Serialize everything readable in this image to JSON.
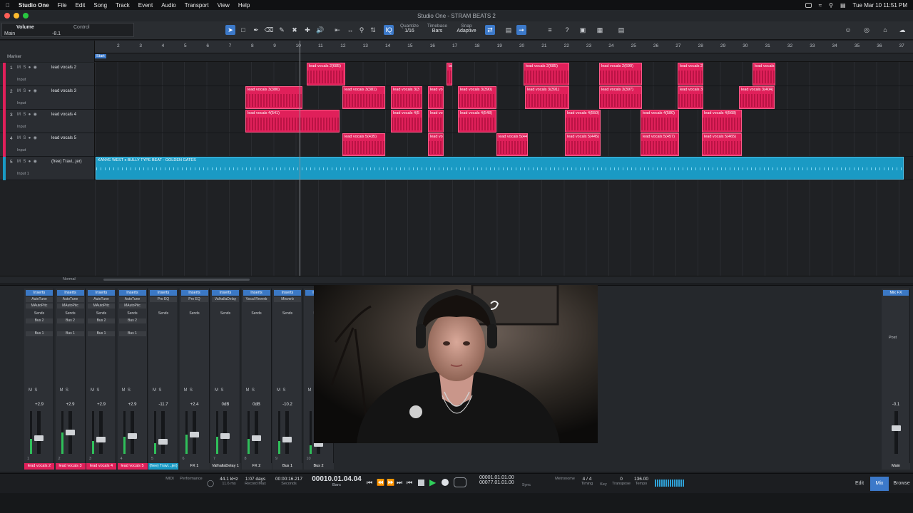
{
  "menubar": {
    "app_name": "Studio One",
    "items": [
      "File",
      "Edit",
      "Song",
      "Track",
      "Event",
      "Audio",
      "Transport",
      "View",
      "Help"
    ],
    "clock": "Tue Mar 10  11:51 PM"
  },
  "window": {
    "title": "Studio One - STRAM BEATS 2"
  },
  "toolbar": {
    "volume_label": "Volume",
    "control_label": "Control",
    "main_label": "Main",
    "volume_value": "-8.1",
    "quantize_label": "Quantize",
    "quantize_value": "1/16",
    "timebase_label": "Timebase",
    "timebase_value": "Bars",
    "snap_label": "Snap",
    "snap_value": "Adaptive"
  },
  "arrange": {
    "marker_label": "Marker",
    "start_label": "Start",
    "bars": [
      "2",
      "3",
      "4",
      "5",
      "6",
      "7",
      "8",
      "9",
      "10",
      "11",
      "12",
      "13",
      "14",
      "15",
      "16",
      "17",
      "18",
      "19",
      "20",
      "21",
      "22",
      "23",
      "24",
      "25",
      "26",
      "27",
      "28",
      "29",
      "30",
      "31",
      "32",
      "33",
      "34",
      "35",
      "36",
      "37"
    ],
    "tracks": [
      {
        "num": "1",
        "name": "lead vocals 2",
        "input": "Input",
        "color": "#e0205a"
      },
      {
        "num": "2",
        "name": "lead vocals 3",
        "input": "Input",
        "color": "#e0205a"
      },
      {
        "num": "3",
        "name": "lead vocals 4",
        "input": "Input",
        "color": "#e0205a"
      },
      {
        "num": "4",
        "name": "lead vocals 5",
        "input": "Input",
        "color": "#e0205a"
      },
      {
        "num": "5",
        "name": "(free) Travi...jer)",
        "input": "Input 1",
        "color": "#1a9ac4"
      }
    ],
    "clips": {
      "row1": [
        "lead vocals 2(685)",
        "la",
        "lead vocals 2(685)",
        "lead vocals 2(690)",
        "lead vocals 2(",
        "lead vocals"
      ],
      "row2": [
        "lead vocals 3(380)",
        "lead vocals 3(381)",
        "lead vocals 3(3",
        "lead vo",
        "lead vocals 3(390)",
        "lead vocals 3(391)",
        "lead vocals 3(397)",
        "lead vocals 3(",
        "lead vocals 3(404)"
      ],
      "row3": [
        "lead vocals 4(541)",
        "lead vocals 4(5",
        "lead vo",
        "lead vocals 4(548)",
        "lead vocals 4(550)",
        "lead vocals 4(580)",
        "lead vocals 4(568)"
      ],
      "row4": [
        "lead vocals 5(435)",
        "lead vo",
        "lead vocals 5(442",
        "lead vocals 5(445)",
        "lead vocals 5(457)",
        "lead vocals 5(465)"
      ],
      "beat": "KANYE WEST x BULLY TYPE BEAT - GOLDEN GATES"
    },
    "footer_mode": "Normal"
  },
  "mixer": {
    "inserts_label": "Inserts",
    "sends_label": "Sends",
    "channels": [
      {
        "name": "lead vocals 2",
        "plugins": [
          "AutoTune",
          "MAutoPitc"
        ],
        "send": "Bus 2",
        "bus": "Bus 1",
        "vol": "+2.9",
        "num": "1",
        "color": "#e0205a",
        "level": 0.35
      },
      {
        "name": "lead vocals 3",
        "plugins": [
          "AutoTune",
          "MAutoPitc"
        ],
        "send": "Bus 2",
        "bus": "Bus 1",
        "vol": "+2.9",
        "num": "2",
        "color": "#e0205a",
        "level": 0.5
      },
      {
        "name": "lead vocals 4",
        "plugins": [
          "AutoTune",
          "MAutoPitc"
        ],
        "send": "Bus 2",
        "bus": "Bus 1",
        "vol": "+2.9",
        "num": "3",
        "color": "#e0205a",
        "level": 0.3
      },
      {
        "name": "lead vocals 5",
        "plugins": [
          "AutoTune",
          "MAutoPitc"
        ],
        "send": "Bus 2",
        "bus": "Bus 1",
        "vol": "+2.9",
        "num": "4",
        "color": "#e0205a",
        "level": 0.4
      },
      {
        "name": "(free) Travi...jer)",
        "plugins": [
          "Pro EQ",
          ""
        ],
        "send": "",
        "bus": "",
        "vol": "-11.7",
        "num": "5",
        "color": "#1a9ac4",
        "level": 0.25
      },
      {
        "name": "FX 1",
        "plugins": [
          "Pro EQ",
          ""
        ],
        "send": "",
        "bus": "",
        "vol": "+2.4",
        "num": "6",
        "color": "#2d3035",
        "level": 0.45
      },
      {
        "name": "ValhallaDelay 1",
        "plugins": [
          "ValhallaDelay",
          ""
        ],
        "send": "",
        "bus": "",
        "vol": "0dB",
        "num": "7",
        "color": "#2d3035",
        "level": 0.4
      },
      {
        "name": "FX 2",
        "plugins": [
          "Vocal Reverb",
          ""
        ],
        "send": "",
        "bus": "",
        "vol": "0dB",
        "num": "8",
        "color": "#2d3035",
        "level": 0.35
      },
      {
        "name": "Bus 1",
        "plugins": [
          "Mixverb",
          ""
        ],
        "send": "",
        "bus": "",
        "vol": "-10.2",
        "num": "9",
        "color": "#2d3035",
        "level": 0.3
      },
      {
        "name": "Bus 2",
        "plugins": [
          "",
          ""
        ],
        "send": "",
        "bus": "",
        "vol": "",
        "num": "10",
        "color": "#2d3035",
        "level": 0.2
      }
    ],
    "mix_fx_label": "Mix FX",
    "post_label": "Post",
    "main_name": "Main",
    "main_vol": "-0.1"
  },
  "transport": {
    "midi_label": "MIDI",
    "performance_label": "Performance",
    "sample_rate": "44.1 kHz",
    "latency": "11.6 ms",
    "record_max_value": "1:07 days",
    "record_max_label": "Record Max",
    "seconds_value": "00:00:16.217",
    "seconds_label": "Seconds",
    "position": "00010.01.04.04",
    "bars_label": "Bars",
    "loop_l": "00001.01.01.00",
    "loop_r": "00077.01.01.00",
    "sync_label": "Sync",
    "metronome_label": "Metronome",
    "timing_value": "4 / 4",
    "timing_label": "Timing",
    "key_label": "Key",
    "transpose_value": "0",
    "transpose_label": "Transpose",
    "tempo_value": "136.00",
    "tempo_label": "Tempo",
    "edit_tab": "Edit",
    "mix_tab": "Mix",
    "browse_tab": "Browse"
  }
}
